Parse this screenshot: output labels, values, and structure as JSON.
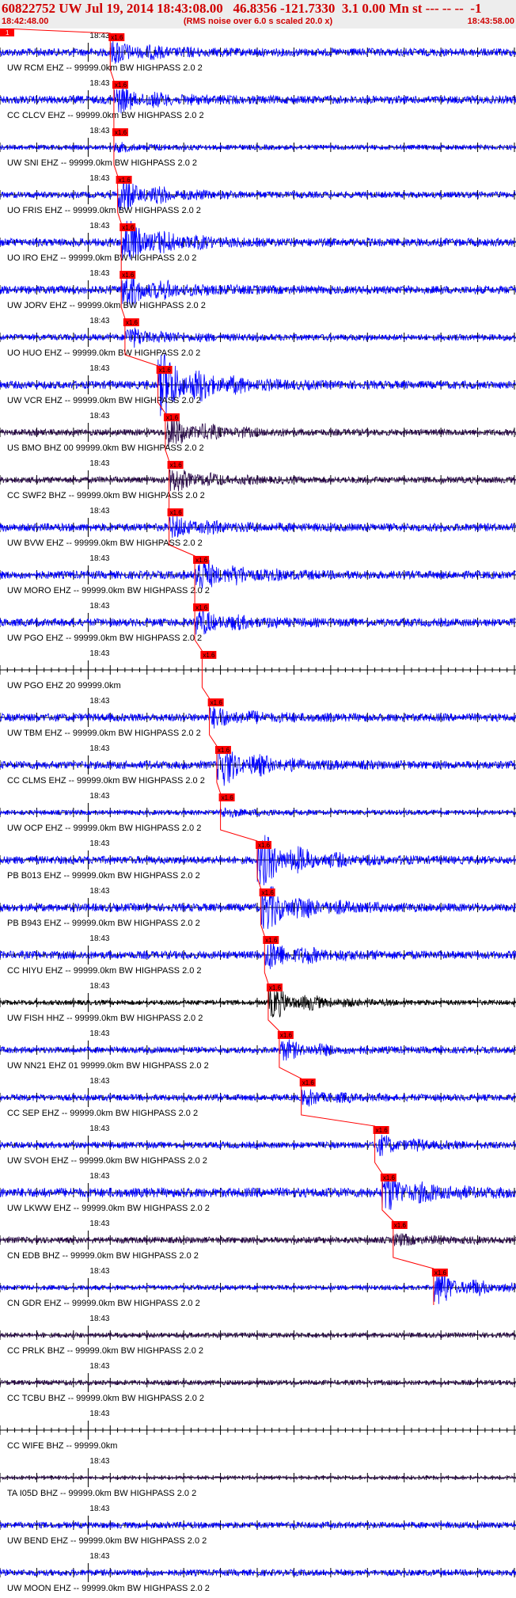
{
  "header": {
    "title": "60822752 UW Jul 19, 2014 18:43:08.00   46.8356 -121.7330  3.1 0.00 Mn st --- -- --  -1",
    "subtitle": "(RMS noise over 6.0 s scaled 20.0 x)",
    "start_time": "18:42:48.00",
    "end_time": "18:43:58.00"
  },
  "chart_data": {
    "type": "line",
    "x_range_seconds": [
      0,
      70
    ],
    "minute_tick_label": "18:43",
    "minute_tick_second": 12,
    "tick_interval_seconds": 1,
    "pick_label": "x1.6",
    "origin_marker_label": "1",
    "colors": {
      "blue": "#0000ff",
      "dark": "#2a0a4a",
      "black": "#000000",
      "red": "#ff0000",
      "title_red": "#d00000"
    },
    "channels": [
      {
        "label": "UW RCM EHZ -- 99999.0km BW  HIGHPASS  2.0  2",
        "pick_s": 15.0,
        "color": "blue",
        "amp": 5,
        "burst": 1.8
      },
      {
        "label": "CC CLCV EHZ -- 99999.0km BW  HIGHPASS  2.0  2",
        "pick_s": 15.5,
        "color": "blue",
        "amp": 5,
        "burst": 2.0
      },
      {
        "label": "UW SNI EHZ -- 99999.0km BW  HIGHPASS  2.0  2",
        "pick_s": 15.5,
        "color": "blue",
        "amp": 3,
        "burst": 1.0
      },
      {
        "label": "UO FRIS EHZ -- 99999.0km BW  HIGHPASS  2.0  2",
        "pick_s": 16.0,
        "color": "blue",
        "amp": 4,
        "burst": 3.5
      },
      {
        "label": "UO IRO EHZ -- 99999.0km BW  HIGHPASS  2.0  2",
        "pick_s": 16.5,
        "color": "blue",
        "amp": 5,
        "burst": 4.0
      },
      {
        "label": "UW JORV EHZ -- 99999.0km BW  HIGHPASS  2.0  2",
        "pick_s": 16.5,
        "color": "blue",
        "amp": 5,
        "burst": 3.0
      },
      {
        "label": "UO HUO EHZ -- 99999.0km BW  HIGHPASS  2.0  2",
        "pick_s": 17.0,
        "color": "blue",
        "amp": 4,
        "burst": 2.0
      },
      {
        "label": "UW VCR EHZ -- 99999.0km BW  HIGHPASS  2.0  2",
        "pick_s": 21.5,
        "color": "blue",
        "amp": 5,
        "burst": 6.0
      },
      {
        "label": "US BMO BHZ 00 99999.0km BW  HIGHPASS  2.0  2",
        "pick_s": 22.5,
        "color": "dark",
        "amp": 4,
        "burst": 3.5
      },
      {
        "label": "CC SWF2 BHZ -- 99999.0km BW  HIGHPASS  2.0  2",
        "pick_s": 23.0,
        "color": "dark",
        "amp": 4,
        "burst": 2.5
      },
      {
        "label": "UW BVW EHZ -- 99999.0km BW  HIGHPASS  2.0  2",
        "pick_s": 23.0,
        "color": "blue",
        "amp": 5,
        "burst": 1.6
      },
      {
        "label": "UW MORO EHZ -- 99999.0km BW  HIGHPASS  2.0  2",
        "pick_s": 26.5,
        "color": "blue",
        "amp": 5,
        "burst": 3.0
      },
      {
        "label": "UW PGO EHZ -- 99999.0km BW  HIGHPASS  2.0  2",
        "pick_s": 26.5,
        "color": "blue",
        "amp": 5,
        "burst": 2.0
      },
      {
        "label": "UW PGO EHZ 20 99999.0km",
        "pick_s": 27.5,
        "color": "blue",
        "amp": 0,
        "burst": 0
      },
      {
        "label": "UW TBM EHZ -- 99999.0km BW  HIGHPASS  2.0  2",
        "pick_s": 28.5,
        "color": "blue",
        "amp": 5,
        "burst": 1.6
      },
      {
        "label": "CC CLMS EHZ -- 99999.0km BW  HIGHPASS  2.0  2",
        "pick_s": 29.5,
        "color": "blue",
        "amp": 5,
        "burst": 3.5
      },
      {
        "label": "UW OCP EHZ -- 99999.0km BW  HIGHPASS  2.0  2",
        "pick_s": 30.0,
        "color": "blue",
        "amp": 3,
        "burst": 1.2
      },
      {
        "label": "PB B013 EHZ -- 99999.0km BW  HIGHPASS  2.0  2",
        "pick_s": 35.0,
        "color": "blue",
        "amp": 5,
        "burst": 4.5
      },
      {
        "label": "PB B943 EHZ -- 99999.0km BW  HIGHPASS  2.0  2",
        "pick_s": 35.5,
        "color": "blue",
        "amp": 5,
        "burst": 4.0
      },
      {
        "label": "CC HIYU EHZ -- 99999.0km BW  HIGHPASS  2.0  2",
        "pick_s": 36.0,
        "color": "blue",
        "amp": 5,
        "burst": 2.5
      },
      {
        "label": "UW FISH HHZ -- 99999.0km BW  HIGHPASS  2.0  2",
        "pick_s": 36.5,
        "color": "black",
        "amp": 3,
        "burst": 4.5
      },
      {
        "label": "UW NN21 EHZ 01 99999.0km BW  HIGHPASS  2.0  2",
        "pick_s": 38.0,
        "color": "blue",
        "amp": 4,
        "burst": 2.0
      },
      {
        "label": "CC SEP EHZ -- 99999.0km BW  HIGHPASS  2.0  2",
        "pick_s": 41.0,
        "color": "blue",
        "amp": 4,
        "burst": 1.5
      },
      {
        "label": "UW SVOH EHZ -- 99999.0km BW  HIGHPASS  2.0  2",
        "pick_s": 51.0,
        "color": "blue",
        "amp": 4,
        "burst": 2.0
      },
      {
        "label": "UW LKWW EHZ -- 99999.0km BW  HIGHPASS  2.0  2",
        "pick_s": 52.0,
        "color": "blue",
        "amp": 6,
        "burst": 2.5
      },
      {
        "label": "CN EDB BHZ -- 99999.0km BW  HIGHPASS  2.0  2",
        "pick_s": 53.5,
        "color": "dark",
        "amp": 4,
        "burst": 1.0
      },
      {
        "label": "CN GDR EHZ -- 99999.0km BW  HIGHPASS  2.0  2",
        "pick_s": 59.0,
        "color": "blue",
        "amp": 3,
        "burst": 5.0
      },
      {
        "label": "CC PRLK BHZ -- 99999.0km BW  HIGHPASS  2.0  2",
        "pick_s": null,
        "color": "dark",
        "amp": 3,
        "burst": 1.0
      },
      {
        "label": "CC TCBU BHZ -- 99999.0km BW  HIGHPASS  2.0  2",
        "pick_s": null,
        "color": "dark",
        "amp": 3,
        "burst": 1.0
      },
      {
        "label": "CC WIFE BHZ -- 99999.0km",
        "pick_s": null,
        "color": "dark",
        "amp": 0,
        "burst": 0
      },
      {
        "label": "TA I05D BHZ -- 99999.0km BW  HIGHPASS  2.0  2",
        "pick_s": null,
        "color": "dark",
        "amp": 2,
        "burst": 1.0
      },
      {
        "label": "UW BEND EHZ -- 99999.0km BW  HIGHPASS  2.0  2",
        "pick_s": null,
        "color": "blue",
        "amp": 4,
        "burst": 1.0
      },
      {
        "label": "UW MOON EHZ -- 99999.0km BW  HIGHPASS  2.0  2",
        "pick_s": null,
        "color": "blue",
        "amp": 4,
        "burst": 1.0
      }
    ]
  }
}
